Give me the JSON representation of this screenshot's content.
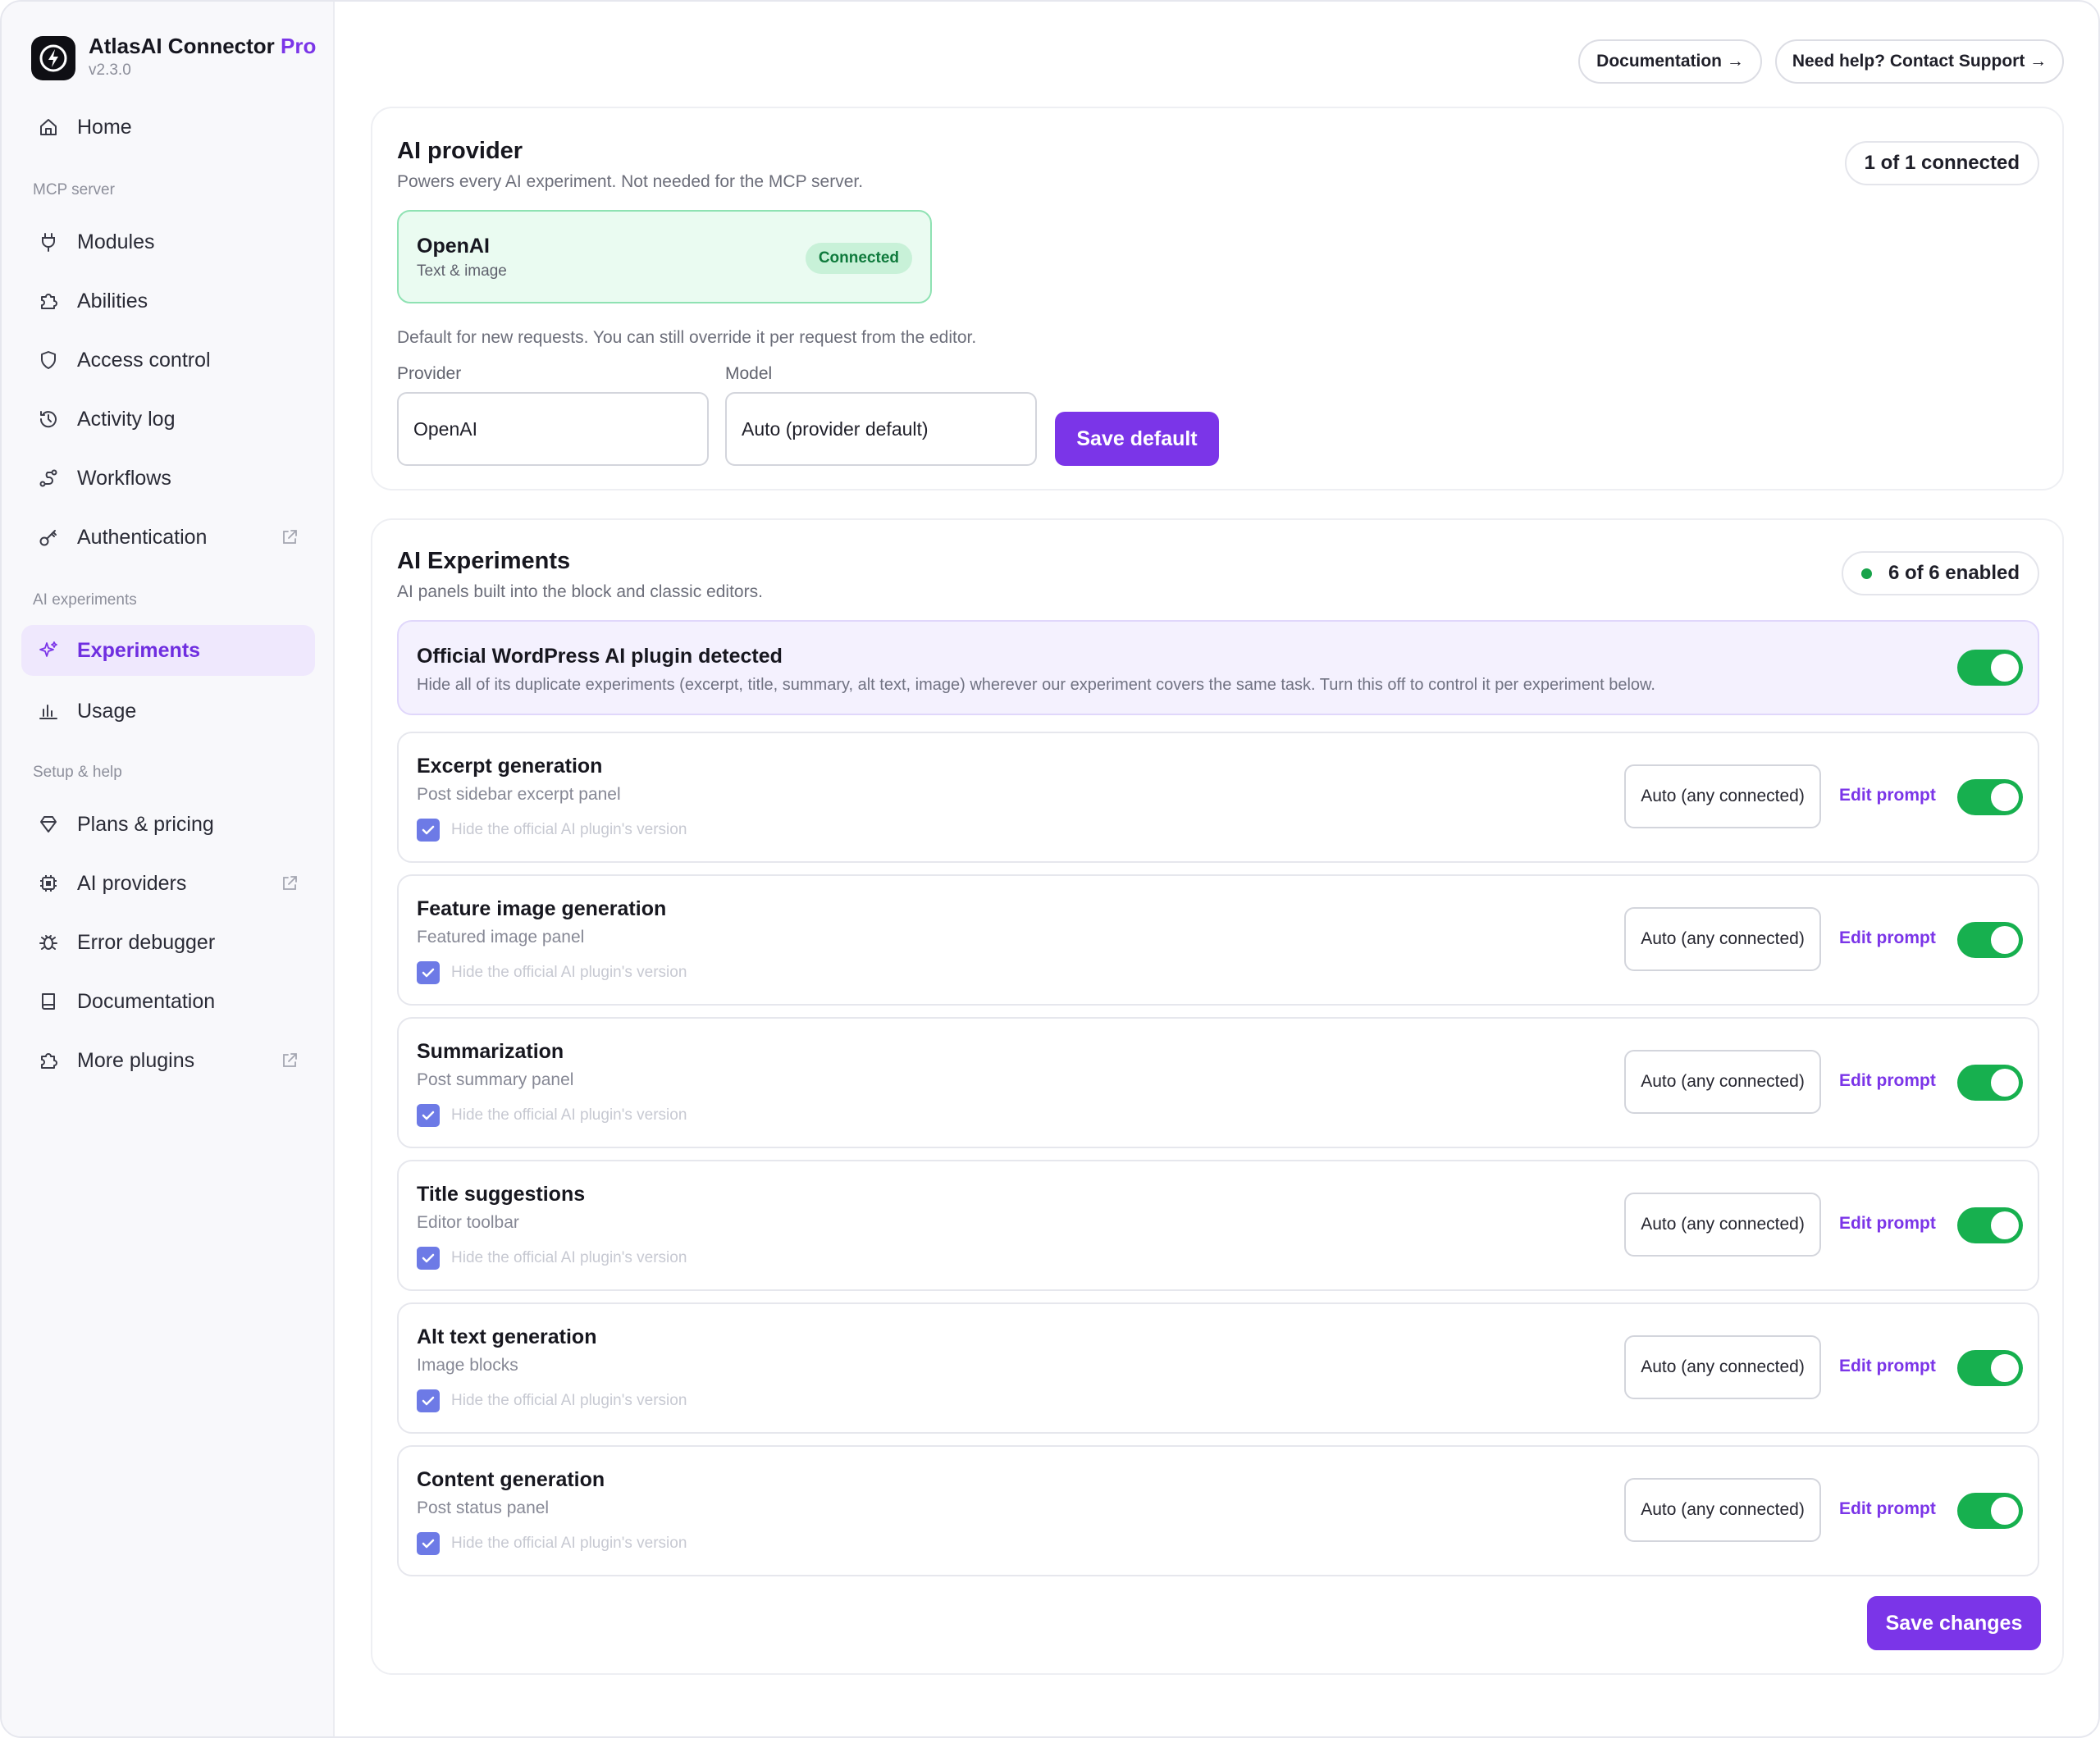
{
  "brand": {
    "name": "AtlasAI Connector",
    "tier": "Pro",
    "version": "v2.3.0"
  },
  "nav": {
    "home": "Home",
    "sections": {
      "mcp": "MCP server",
      "ai": "AI experiments",
      "help": "Setup & help"
    },
    "mcp_items": [
      "Modules",
      "Abilities",
      "Access control",
      "Activity log",
      "Workflows",
      "Authentication"
    ],
    "ai_items": [
      "Experiments",
      "Usage"
    ],
    "help_items": [
      "Plans & pricing",
      "AI providers",
      "Error debugger",
      "Documentation",
      "More plugins"
    ],
    "active": "Experiments"
  },
  "header": {
    "docs_label": "Documentation →",
    "support_label": "Need help? Contact Support →"
  },
  "provider_card": {
    "title": "AI provider",
    "subtitle": "Powers every AI experiment. Not needed for the MCP server.",
    "status_pill": "1 of 1 connected",
    "tile": {
      "name": "OpenAI",
      "description": "Text & image",
      "badge": "Connected"
    },
    "default_note": "Default for new requests. You can still override it per request from the editor.",
    "provider_label": "Provider",
    "provider_value": "OpenAI",
    "model_label": "Model",
    "model_value": "Auto (provider default)",
    "save_label": "Save default"
  },
  "experiments_card": {
    "title": "AI Experiments",
    "subtitle": "AI panels built into the block and classic editors.",
    "status_pill": "6 of 6 enabled",
    "banner": {
      "title": "Official WordPress AI plugin detected",
      "description": "Hide all of its duplicate experiments (excerpt, title, summary, alt text, image) wherever our experiment covers the same task. Turn this off to control it per experiment below.",
      "enabled": true
    },
    "model_label": "Auto (any connected)",
    "edit_label": "Edit prompt",
    "hide_label": "Hide the official AI plugin's version",
    "items": [
      {
        "title": "Excerpt generation",
        "subtitle": "Post sidebar excerpt panel",
        "enabled": true,
        "hide_official": true
      },
      {
        "title": "Feature image generation",
        "subtitle": "Featured image panel",
        "enabled": true,
        "hide_official": true
      },
      {
        "title": "Summarization",
        "subtitle": "Post summary panel",
        "enabled": true,
        "hide_official": true
      },
      {
        "title": "Title suggestions",
        "subtitle": "Editor toolbar",
        "enabled": true,
        "hide_official": true
      },
      {
        "title": "Alt text generation",
        "subtitle": "Image blocks",
        "enabled": true,
        "hide_official": true
      },
      {
        "title": "Content generation",
        "subtitle": "Post status panel",
        "enabled": true,
        "hide_official": true
      }
    ],
    "save_label": "Save changes"
  },
  "colors": {
    "accent": "#7b35e8",
    "toggle_on": "#17b04f",
    "connected_bg": "#eafbf1"
  }
}
